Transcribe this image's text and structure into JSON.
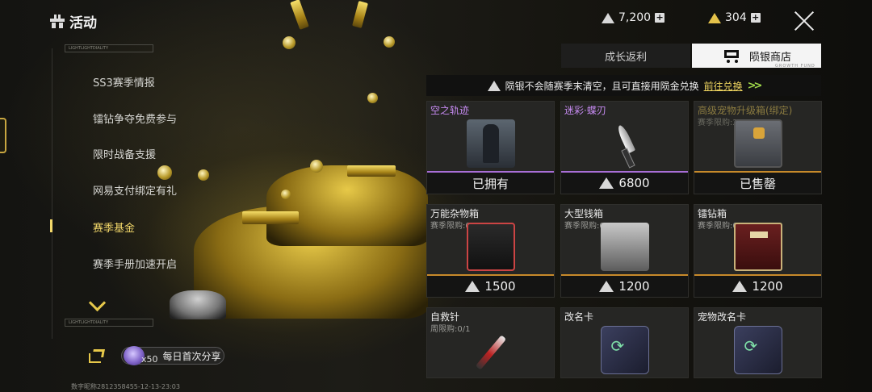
{
  "header": {
    "title": "活动",
    "currencies": [
      {
        "name": "silver",
        "value": "7,200",
        "color": "#d8d8d8"
      },
      {
        "name": "gold",
        "value": "304",
        "color": "#e4c24a"
      }
    ]
  },
  "nav": {
    "tag_top": "LIGHTLIGHTDIALITY",
    "tag_bottom": "LIGHTLIGHTDIALITY",
    "items": [
      {
        "label": "SS3赛季情报",
        "active": false
      },
      {
        "label": "镭钻争夺免费参与",
        "active": false
      },
      {
        "label": "限时战备支援",
        "active": false
      },
      {
        "label": "网易支付绑定有礼",
        "active": false
      },
      {
        "label": "赛季基金",
        "active": true
      },
      {
        "label": "赛季手册加速开启",
        "active": false
      }
    ],
    "share": {
      "count": "x50",
      "label": "每日首次分享"
    },
    "footer_id": "数字昵称2812358455-12-13-23:03"
  },
  "tabs": {
    "growth": "成长返利",
    "shop": "陨银商店",
    "shop_sub": "GROWTH FUND"
  },
  "notice": {
    "text": "陨银不会随赛季末清空，且可直接用陨金兑换",
    "link": "前往兑换"
  },
  "shop_items": [
    {
      "name": "空之轨迹",
      "limit": "",
      "status": "已拥有",
      "price": "",
      "style": "purple",
      "icon": "soldier-skin-icon"
    },
    {
      "name": "迷彩·蝶刃",
      "limit": "",
      "status": "",
      "price": "6800",
      "style": "purple",
      "icon": "butterfly-knife-icon"
    },
    {
      "name": "高级宠物升级箱(绑定)",
      "limit": "赛季限购:2/2",
      "status": "已售罄",
      "price": "",
      "style": "dim",
      "icon": "pet-upgrade-crate-icon"
    },
    {
      "name": "万能杂物箱",
      "limit": "赛季限购:0/1",
      "status": "",
      "price": "1500",
      "style": "normal",
      "icon": "utility-box-icon"
    },
    {
      "name": "大型钱箱",
      "limit": "赛季限购:0/1",
      "status": "",
      "price": "1200",
      "style": "normal",
      "icon": "money-case-icon"
    },
    {
      "name": "镭钻箱",
      "limit": "赛季限购:0/1",
      "status": "",
      "price": "1200",
      "style": "normal",
      "icon": "diamond-case-icon"
    },
    {
      "name": "自救针",
      "limit": "周限购:0/1",
      "status": "",
      "price": "",
      "style": "normal",
      "icon": "syringe-icon"
    },
    {
      "name": "改名卡",
      "limit": "",
      "status": "",
      "price": "",
      "style": "normal",
      "icon": "rename-card-icon"
    },
    {
      "name": "宠物改名卡",
      "limit": "",
      "status": "",
      "price": "",
      "style": "normal",
      "icon": "pet-rename-card-icon"
    }
  ]
}
